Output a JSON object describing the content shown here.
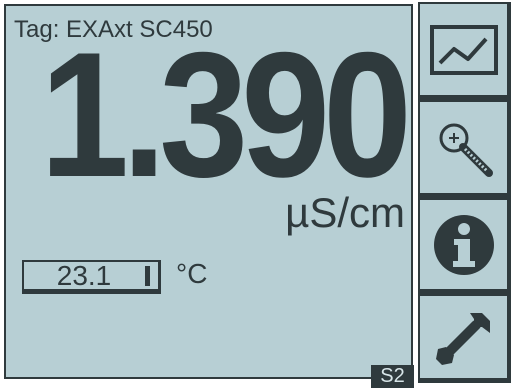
{
  "header": {
    "tag_label": "Tag: EXAxt SC450"
  },
  "measurement": {
    "value": "1.390",
    "unit": "µS/cm"
  },
  "temperature": {
    "value": "23.1",
    "unit": "°C"
  },
  "status": {
    "badge": "S2"
  },
  "side_buttons": [
    {
      "name": "trend",
      "icon": "trend-graph-icon"
    },
    {
      "name": "zoom",
      "icon": "magnifier-icon"
    },
    {
      "name": "info",
      "icon": "info-icon"
    },
    {
      "name": "setup",
      "icon": "wrench-icon"
    }
  ],
  "colors": {
    "background": "#b7cfd4",
    "foreground": "#2f3a3d"
  }
}
